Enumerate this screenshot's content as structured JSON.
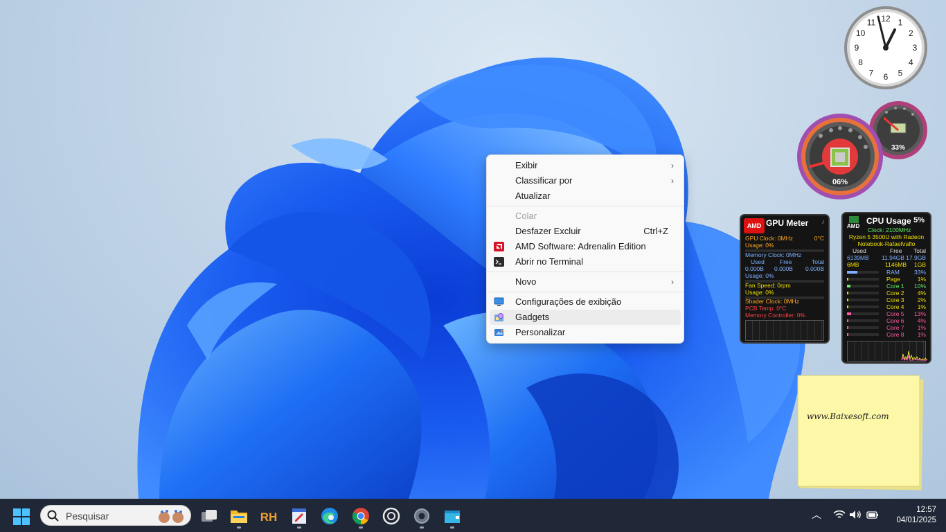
{
  "context_menu": {
    "items": [
      {
        "label": "Exibir",
        "submenu": true
      },
      {
        "label": "Classificar por",
        "submenu": true
      },
      {
        "label": "Atualizar"
      },
      {
        "label": "Colar",
        "disabled": true
      },
      {
        "label": "Desfazer Excluir",
        "shortcut": "Ctrl+Z"
      },
      {
        "label": "AMD Software: Adrenalin Edition",
        "icon": "amd-icon"
      },
      {
        "label": "Abrir no Terminal",
        "icon": "terminal-icon"
      },
      {
        "label": "Novo",
        "submenu": true
      },
      {
        "label": "Configurações de exibição",
        "icon": "display-icon"
      },
      {
        "label": "Gadgets",
        "icon": "gadgets-icon",
        "highlighted": true
      },
      {
        "label": "Personalizar",
        "icon": "personalize-icon"
      }
    ]
  },
  "clock": {
    "numbers": [
      "12",
      "1",
      "2",
      "3",
      "4",
      "5",
      "6",
      "7",
      "8",
      "9",
      "10",
      "11"
    ],
    "time": "12:57"
  },
  "meters": {
    "cpu_percent": "06%",
    "ram_percent": "33%"
  },
  "gpu_meter": {
    "brand": "AMD",
    "title": "GPU Meter",
    "gpu_clock": "GPU Clock: 0MHz",
    "gpu_temp": "0°C",
    "gpu_usage": "Usage: 0%",
    "memory_clock": "Memory Clock: 0MHz",
    "mem_headers": [
      "Used",
      "Free",
      "Total"
    ],
    "mem_values": [
      "0.000B",
      "0.000B",
      "0.000B"
    ],
    "mem_usage": "Usage: 0%",
    "fan_speed": "Fan Speed: 0rpm",
    "fan_usage": "Usage: 0%",
    "shader_clock": "Shader Clock: 0MHz",
    "pcb_temp": "PCB Temp: 0°C",
    "memory_controller": "Memory Controller: 0%"
  },
  "cpu_usage": {
    "brand": "AMD",
    "title": "CPU Usage",
    "total": "5%",
    "clock": "Clock: 2100MHz",
    "cpu_name": "Ryzen 5 3500U with Radeon",
    "machine": "Notebook-Rafael\\raflo",
    "headers": [
      "Used",
      "Free",
      "Total"
    ],
    "ram_row": [
      "6139MB",
      "11.94GB",
      "17.9GB"
    ],
    "page_row": [
      "6MB",
      "1146MB",
      "1GB"
    ],
    "rows": [
      {
        "label": "RAM",
        "value": "33%",
        "fraction": 0.33,
        "color": "#7fb0ff"
      },
      {
        "label": "Page",
        "value": "1%",
        "fraction": 0.01,
        "color": "#f0e000"
      },
      {
        "label": "Core 1",
        "value": "10%",
        "fraction": 0.1,
        "color": "#6e6"
      },
      {
        "label": "Core 2",
        "value": "4%",
        "fraction": 0.04,
        "color": "#f0e000"
      },
      {
        "label": "Core 3",
        "value": "2%",
        "fraction": 0.02,
        "color": "#f0e000"
      },
      {
        "label": "Core 4",
        "value": "1%",
        "fraction": 0.01,
        "color": "#f0e000"
      },
      {
        "label": "Core 5",
        "value": "13%",
        "fraction": 0.13,
        "color": "#ff5aa0"
      },
      {
        "label": "Core 6",
        "value": "4%",
        "fraction": 0.04,
        "color": "#ff5aa0"
      },
      {
        "label": "Core 7",
        "value": "1%",
        "fraction": 0.01,
        "color": "#ff5aa0"
      },
      {
        "label": "Core 8",
        "value": "1%",
        "fraction": 0.01,
        "color": "#ff5aa0"
      }
    ]
  },
  "sticky_note": {
    "text": "www.Baixesoft.com"
  },
  "taskbar": {
    "search_placeholder": "Pesquisar",
    "apps": [
      "task-view-icon",
      "file-explorer-icon",
      "rh-app-icon",
      "editor-icon",
      "edge-icon",
      "chrome-icon",
      "chatgpt-icon",
      "settings-icon",
      "store-icon"
    ],
    "time": "12:57",
    "date": "04/01/2025"
  },
  "colors": {
    "taskbar": "#202837",
    "menu_bg": "#f9f9f9",
    "accent_blue": "#1e6fff"
  }
}
